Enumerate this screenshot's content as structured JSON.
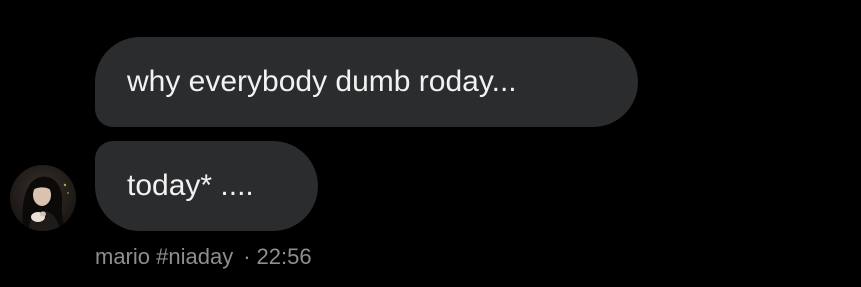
{
  "messages": [
    {
      "text": "why everybody dumb roday..."
    },
    {
      "text": "today* ...."
    }
  ],
  "sender": {
    "name": "mario #niaday",
    "separator": "·",
    "time": "22:56",
    "avatar_icon": "profile-photo"
  },
  "colors": {
    "background": "#000000",
    "bubble": "#2b2c2e",
    "text": "#f2f2f2",
    "meta_text": "#8d8e92"
  }
}
